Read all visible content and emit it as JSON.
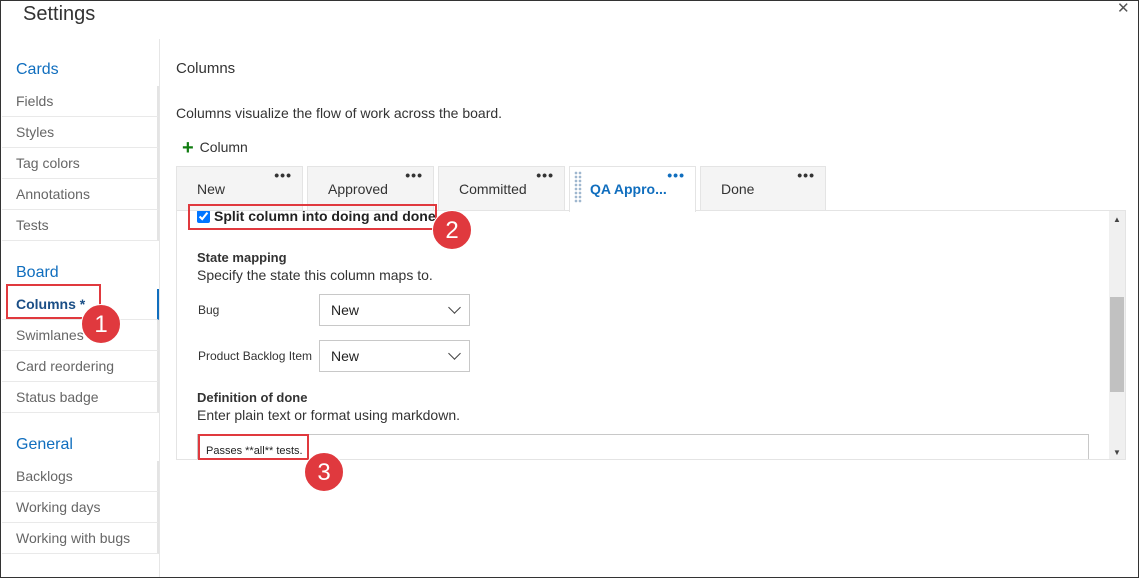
{
  "window": {
    "title": "Settings",
    "close_glyph": "✕"
  },
  "sidebar": {
    "sections": [
      {
        "label": "Cards"
      },
      {
        "label": "Board"
      },
      {
        "label": "General"
      }
    ],
    "cards_items": [
      "Fields",
      "Styles",
      "Tag colors",
      "Annotations",
      "Tests"
    ],
    "board_items": [
      "Columns *",
      "Swimlanes",
      "Card reordering",
      "Status badge"
    ],
    "general_items": [
      "Backlogs",
      "Working days",
      "Working with bugs"
    ],
    "active_item": "Columns *"
  },
  "main": {
    "title": "Columns",
    "description": "Columns visualize the flow of work across the board.",
    "add_column_label": "Column",
    "tabs": [
      {
        "label": "New",
        "menu": "•••"
      },
      {
        "label": "Approved",
        "menu": "•••"
      },
      {
        "label": "Committed",
        "menu": "•••"
      },
      {
        "label": "QA Appro...",
        "menu": "•••",
        "active": true
      },
      {
        "label": "Done",
        "menu": "•••"
      }
    ],
    "split_label": "Split column into doing and done",
    "split_checked": true,
    "state_mapping_title": "State mapping",
    "state_mapping_desc": "Specify the state this column maps to.",
    "mappings": [
      {
        "label": "Bug",
        "value": "New"
      },
      {
        "label": "Product Backlog Item",
        "value": "New"
      }
    ],
    "dod_title": "Definition of done",
    "dod_desc": "Enter plain text or format using markdown.",
    "dod_value": "Passes **all** tests."
  },
  "annotations": {
    "markers": [
      "1",
      "2",
      "3"
    ],
    "color": "#e0393e"
  },
  "colors": {
    "accent": "#106ebe",
    "add_icon": "#107c10"
  },
  "icons": [
    "close-icon",
    "plus-icon",
    "more-icon",
    "drag-grip-icon",
    "chevron-down-icon",
    "scroll-up-icon",
    "scroll-down-icon"
  ]
}
